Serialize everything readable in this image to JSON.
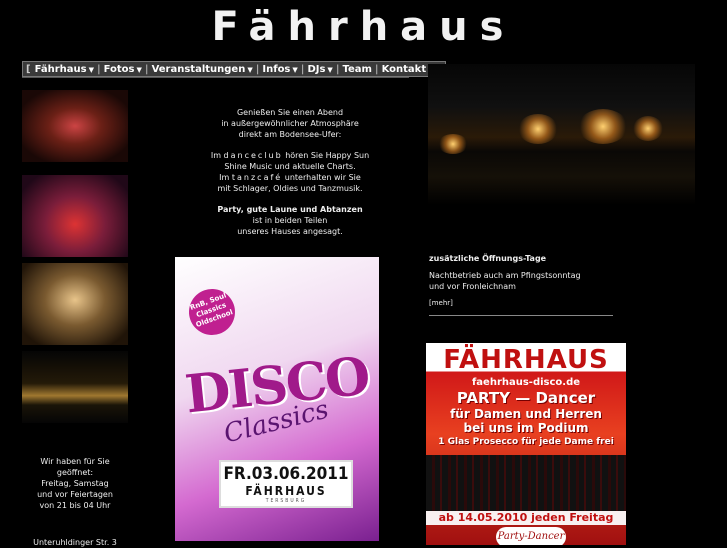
{
  "site": {
    "logo_text": "Fährhaus"
  },
  "nav": {
    "open_bracket": "[",
    "close_bracket": "]",
    "items": [
      {
        "label": "Fährhaus",
        "has_dropdown": true
      },
      {
        "label": "Fotos",
        "has_dropdown": true
      },
      {
        "label": "Veranstaltungen",
        "has_dropdown": true
      },
      {
        "label": "Infos",
        "has_dropdown": true
      },
      {
        "label": "DJs",
        "has_dropdown": true
      },
      {
        "label": "Team",
        "has_dropdown": false
      },
      {
        "label": "Kontakt",
        "has_dropdown": true
      }
    ],
    "separator": "|",
    "caret": "▼"
  },
  "intro": {
    "p1_l1": "Genießen Sie einen Abend",
    "p1_l2": "in außergewöhnlicher Atmosphäre",
    "p1_l3": "direkt am Bodensee-Ufer:",
    "p2_l1_a": "Im",
    "p2_l1_b": "danceclub",
    "p2_l1_c": "hören Sie Happy Sun",
    "p2_l2": "Shine Music und aktuelle Charts.",
    "p2_l3_a": "Im",
    "p2_l3_b": "tanzcafé",
    "p2_l3_c": "unterhalten wir Sie",
    "p2_l4": "mit Schlager, Oldies und Tanzmusik.",
    "p3_bold": "Party, gute Laune und Abtanzen",
    "p3_l2": "ist in beiden Teilen",
    "p3_l3": "unseres Hauses angesagt."
  },
  "opening": {
    "l1": "Wir haben für Sie",
    "l2": "geöffnet:",
    "l3": "Freitag, Samstag",
    "l4": "und vor Feiertagen",
    "l5": "von 21 bis 04 Uhr"
  },
  "address": {
    "street": "Unteruhldinger Str. 3"
  },
  "disco_poster": {
    "badge_l1": "RnB, Soul",
    "badge_l2": "Classics",
    "badge_l3": "Oldschool",
    "word": "DISCO",
    "classics": "Classics",
    "date": "FR.03.06.2011",
    "venue": "FÄHRHAUS",
    "city": "TERSBURG"
  },
  "news": {
    "title": "zusätzliche Öffnungs-Tage",
    "l1": "Nachtbetrieb auch am Pfingstsonntag",
    "l2": "und vor Fronleichnam",
    "more": "[mehr]"
  },
  "party_poster": {
    "title": "FÄHRHAUS",
    "url": "faehrhaus-disco.de",
    "headline": "PARTY — Dancer",
    "l2": "für Damen und Herren",
    "l3": "bei uns im Podium",
    "l4": "1 Glas Prosecco für jede Dame frei",
    "bottom": "ab 14.05.2010 jeden Freitag",
    "ribbon": "Party-Dancer"
  },
  "colors": {
    "background": "#000000",
    "nav_bg": "#3a3a3a",
    "text": "#eeeeee"
  }
}
